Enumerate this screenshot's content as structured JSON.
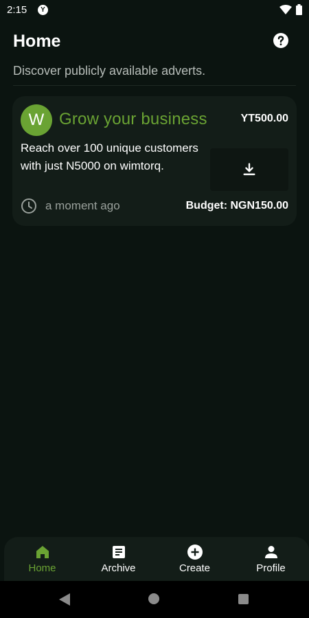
{
  "status_bar": {
    "time": "2:15",
    "app_icon_letter": "Y"
  },
  "header": {
    "title": "Home"
  },
  "subtitle": "Discover publicly available adverts.",
  "advert": {
    "avatar_letter": "W",
    "title": "Grow your business",
    "price": "YT500.00",
    "description": "Reach over 100 unique customers with just N5000 on wimtorq.",
    "posted": "a moment ago",
    "budget": "Budget: NGN150.00"
  },
  "bottom_nav": {
    "items": [
      {
        "label": "Home",
        "icon": "home-icon",
        "active": true
      },
      {
        "label": "Archive",
        "icon": "archive-icon",
        "active": false
      },
      {
        "label": "Create",
        "icon": "add-circle-icon",
        "active": false
      },
      {
        "label": "Profile",
        "icon": "person-icon",
        "active": false
      }
    ]
  },
  "colors": {
    "accent": "#6aa333",
    "background": "#0b1410",
    "card": "#131d18"
  }
}
